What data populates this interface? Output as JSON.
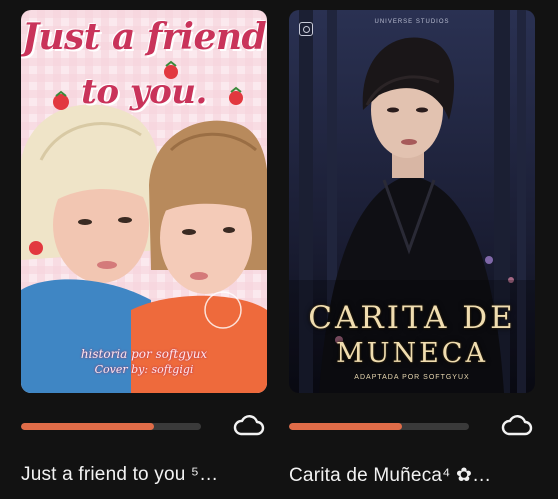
{
  "stories": [
    {
      "title": "Just a friend to you ⁵…",
      "progress": 0.74,
      "offline_icon": "cloud-icon",
      "cover": {
        "title_line1": "Just a friend",
        "title_line2": "to you.",
        "credit_line1": "historia por softgyux",
        "credit_line2": "Cover by: softgigi",
        "accent": "#c9335a"
      }
    },
    {
      "title": "Carita de Muñeca⁴ ✿…",
      "progress": 0.63,
      "offline_icon": "cloud-icon",
      "cover": {
        "publisher": "UNIVERSE STUDIOS",
        "title_line1": "CARITA DE",
        "title_line2": "MUNECA",
        "subtitle": "ADAPTADA POR SOFTGYUX",
        "accent": "#f0ddb0"
      }
    }
  ],
  "colors": {
    "background": "#121212",
    "progress": "#e06c48",
    "text": "#f2f2f2"
  }
}
